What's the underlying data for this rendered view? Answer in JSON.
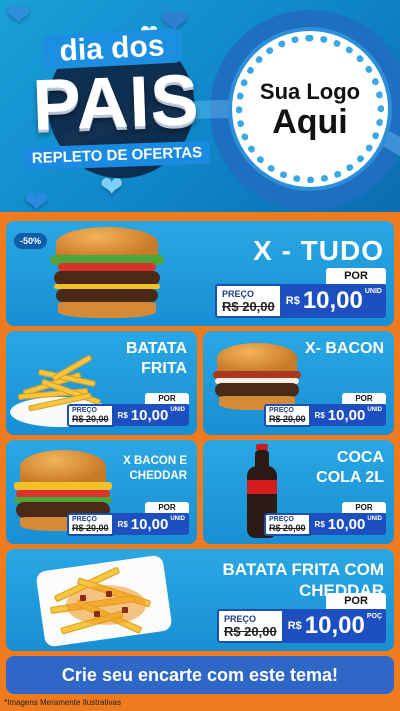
{
  "header": {
    "title_line1": "dia dos",
    "title_line2": "PAIS",
    "subtitle": "REPLETO DE OFERTAS",
    "logo_line1": "Sua Logo",
    "logo_line2": "Aqui"
  },
  "products": {
    "main": {
      "name": "X - TUDO",
      "badge": "-50%",
      "por": "POR",
      "preco_label": "PREÇO",
      "old_price": "R$ 20,00",
      "currency": "R$",
      "price": "10,00",
      "unit": "UNID"
    },
    "p1": {
      "name": "BATATA FRITA",
      "por": "POR",
      "preco_label": "PREÇO",
      "old_price": "R$ 20,00",
      "currency": "R$",
      "price": "10,00",
      "unit": "UNID"
    },
    "p2": {
      "name": "X- BACON",
      "por": "POR",
      "preco_label": "PREÇO",
      "old_price": "R$ 20,00",
      "currency": "R$",
      "price": "10,00",
      "unit": "UNID"
    },
    "p3": {
      "name": "X BACON E CHEDDAR",
      "por": "POR",
      "preco_label": "PREÇO",
      "old_price": "R$ 20,00",
      "currency": "R$",
      "price": "10,00",
      "unit": "UNID"
    },
    "p4": {
      "name": "COCA COLA 2L",
      "por": "POR",
      "preco_label": "PREÇO",
      "old_price": "R$ 20,00",
      "currency": "R$",
      "price": "10,00",
      "unit": "UNID"
    },
    "wide": {
      "name": "BATATA FRITA COM CHEDDAR",
      "por": "POR",
      "preco_label": "PREÇO",
      "old_price": "R$ 20,00",
      "currency": "R$",
      "price": "10,00",
      "unit": "POÇ"
    }
  },
  "cta": "Crie seu encarte com este tema!",
  "footnote": "*Imagens Meramente Ilustrativas",
  "colors": {
    "background": "#f07a1e",
    "card": "#1e9ad9",
    "price_box": "#1d4fc0",
    "cta": "#2f67c6"
  },
  "icons": [
    "heart-icon",
    "burger-image",
    "fries-image",
    "soda-bottle-image"
  ]
}
